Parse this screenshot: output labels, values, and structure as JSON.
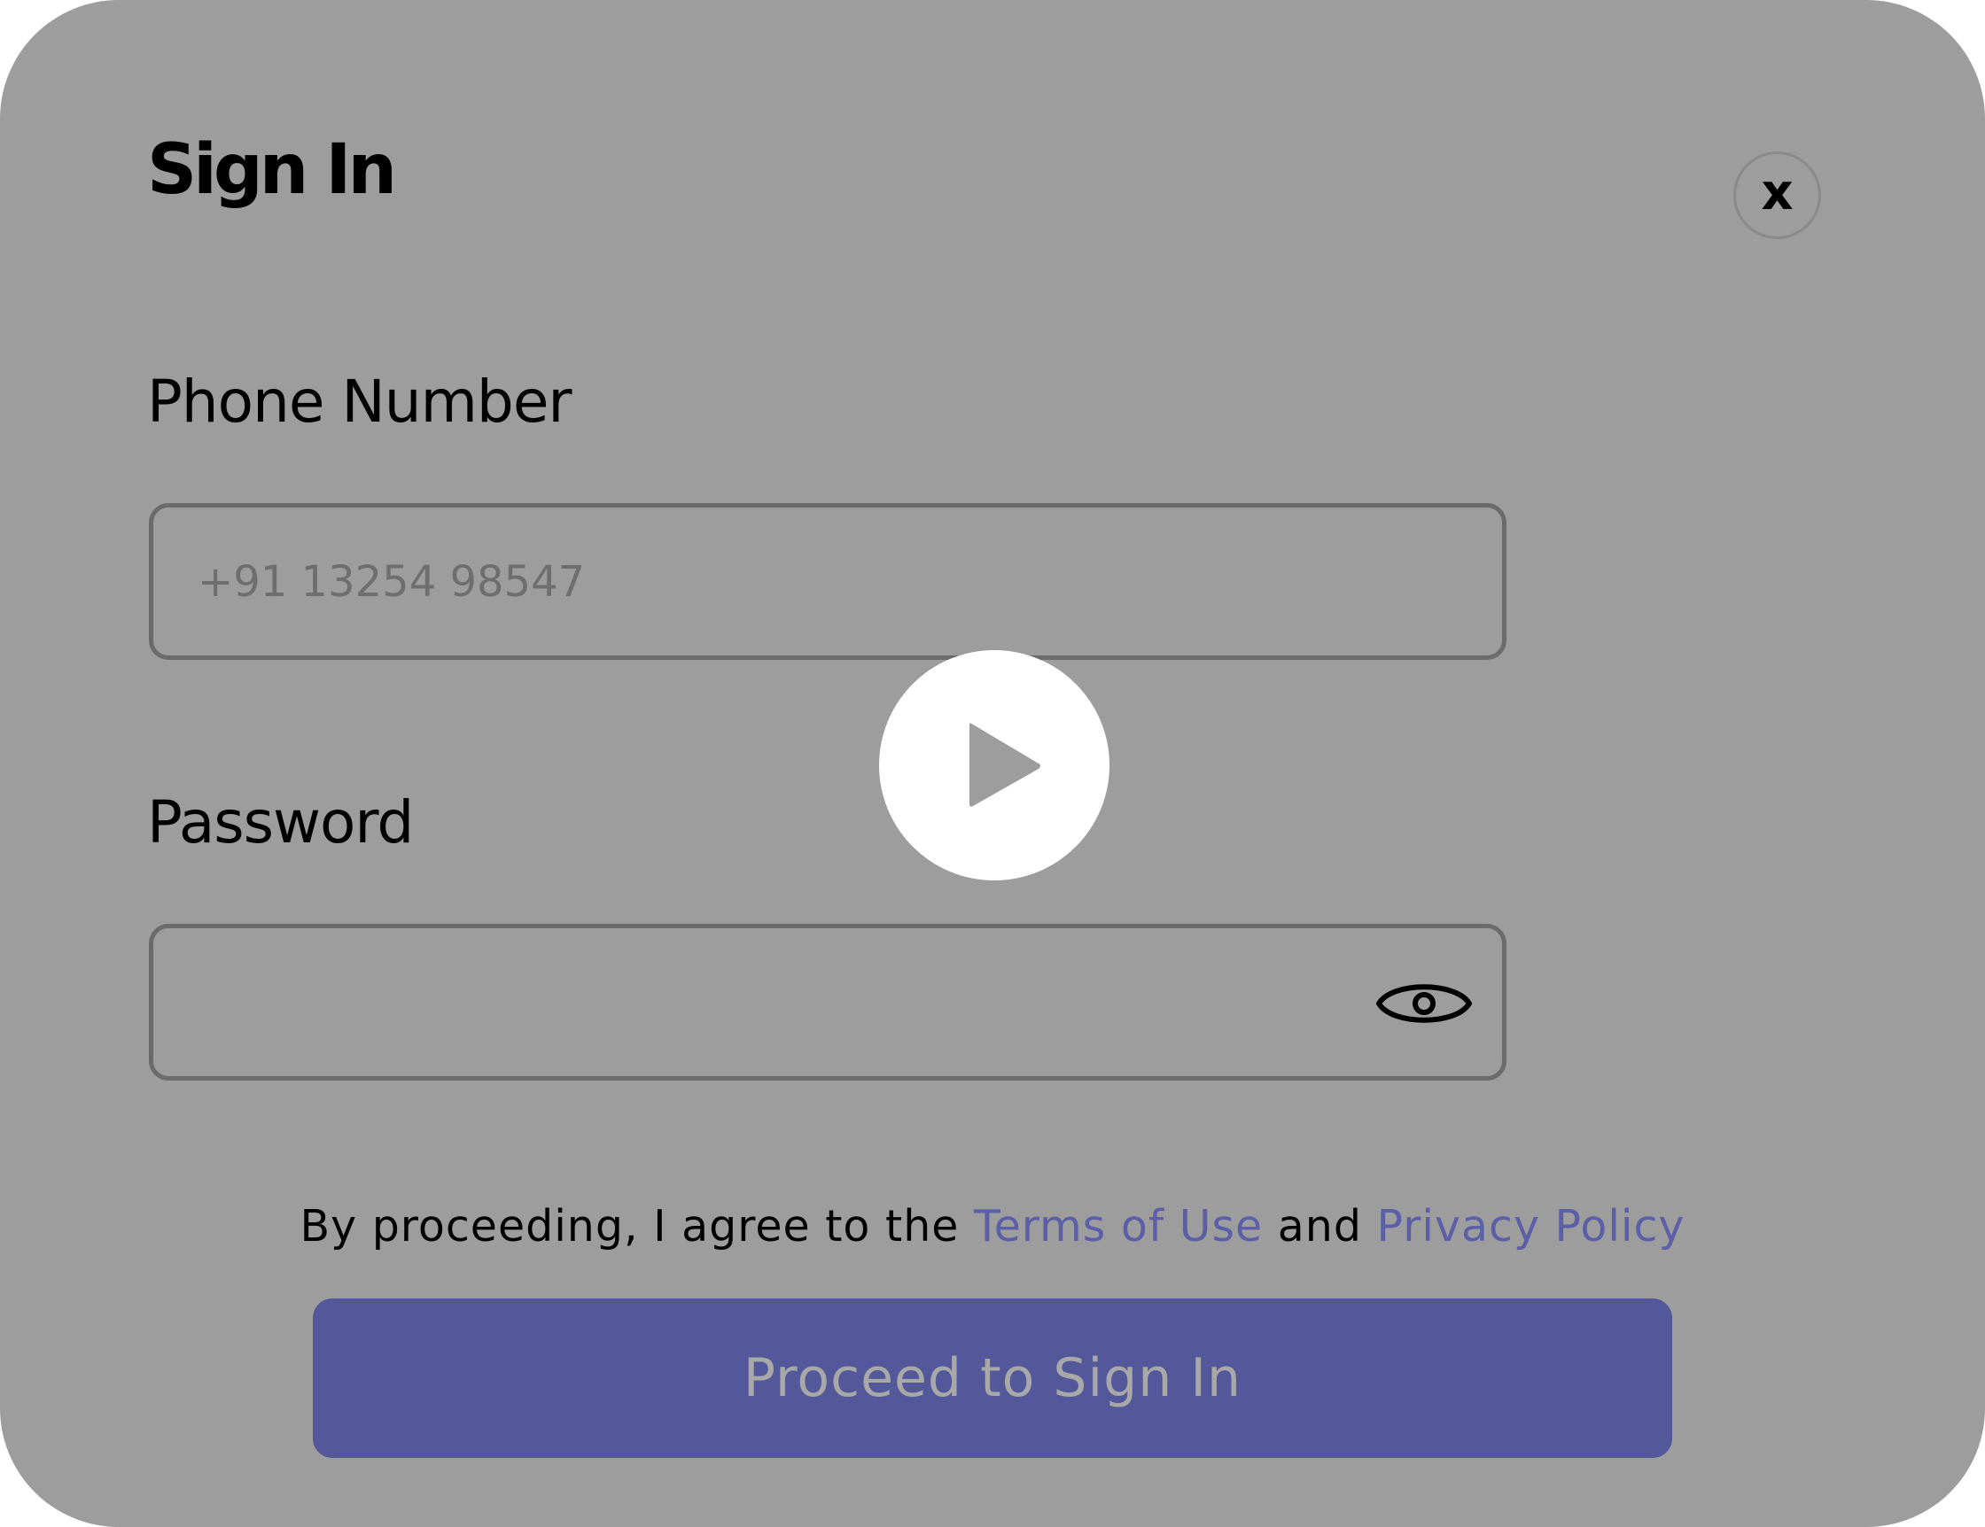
{
  "dialog": {
    "title": "Sign In",
    "close_label": "x"
  },
  "form": {
    "phone": {
      "label": "Phone Number",
      "placeholder": "+91 13254 98547",
      "value": ""
    },
    "password": {
      "label": "Password",
      "value": "",
      "toggle_icon": "eye-icon"
    }
  },
  "consent": {
    "prefix": "By proceeding, I agree to the",
    "terms_link": "Terms of Use",
    "connector": "and",
    "privacy_link": "Privacy Policy"
  },
  "actions": {
    "proceed_label": "Proceed to Sign In"
  },
  "overlay": {
    "icon": "play-icon"
  },
  "colors": {
    "backdrop": "#9d9d9d",
    "accent": "#525899",
    "link": "#5b5fa7",
    "input_border": "#6b6b6b",
    "button_text": "#a8a8a8"
  }
}
